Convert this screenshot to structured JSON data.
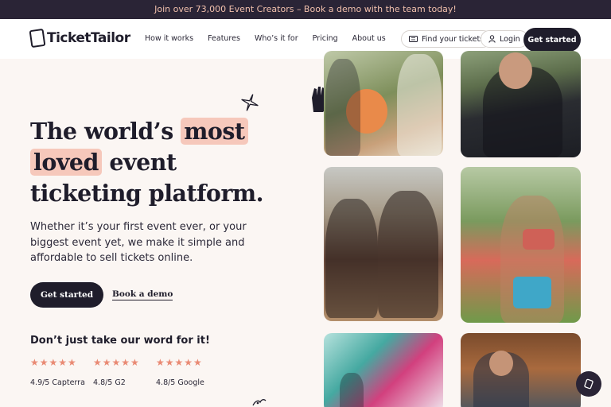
{
  "banner": {
    "text": "Join over 73,000 Event Creators – Book a demo with the team today!"
  },
  "nav": {
    "logo_text": "TicketTailor",
    "links": [
      {
        "label": "How it works"
      },
      {
        "label": "Features"
      },
      {
        "label": "Who’s it for"
      },
      {
        "label": "Pricing"
      },
      {
        "label": "About us"
      }
    ],
    "find_tickets_label": "Find your tickets",
    "login_label": "Login",
    "get_started_label": "Get started"
  },
  "hero": {
    "title_part1": "The world’s",
    "title_highlight1": "most",
    "title_highlight2": "loved",
    "title_part2": "event",
    "title_part3": "ticketing platform.",
    "subtitle": "Whether it’s your first event ever, or your biggest event yet, we make it simple and affordable to sell tickets online.",
    "cta_primary": "Get started",
    "cta_secondary": "Book a demo"
  },
  "reviews": {
    "title": "Don’t just take our word for it!",
    "items": [
      {
        "stars": "★★★★★",
        "label": "4.9/5 Capterra",
        "rating": 4.9
      },
      {
        "stars": "★★★★★",
        "label": "4.8/5 G2",
        "rating": 4.8
      },
      {
        "stars": "★★★★★",
        "label": "4.8/5 Google",
        "rating": 4.8
      }
    ]
  },
  "colors": {
    "accent": "#1f1d2b",
    "highlight": "#f6c8bb",
    "stars": "#e98a74",
    "banner_bg": "#2a2436",
    "banner_text": "#f2c1ad"
  },
  "icons": {
    "find_tickets": "ticket-icon",
    "login": "user-icon",
    "chat": "ticket-chat-icon"
  }
}
